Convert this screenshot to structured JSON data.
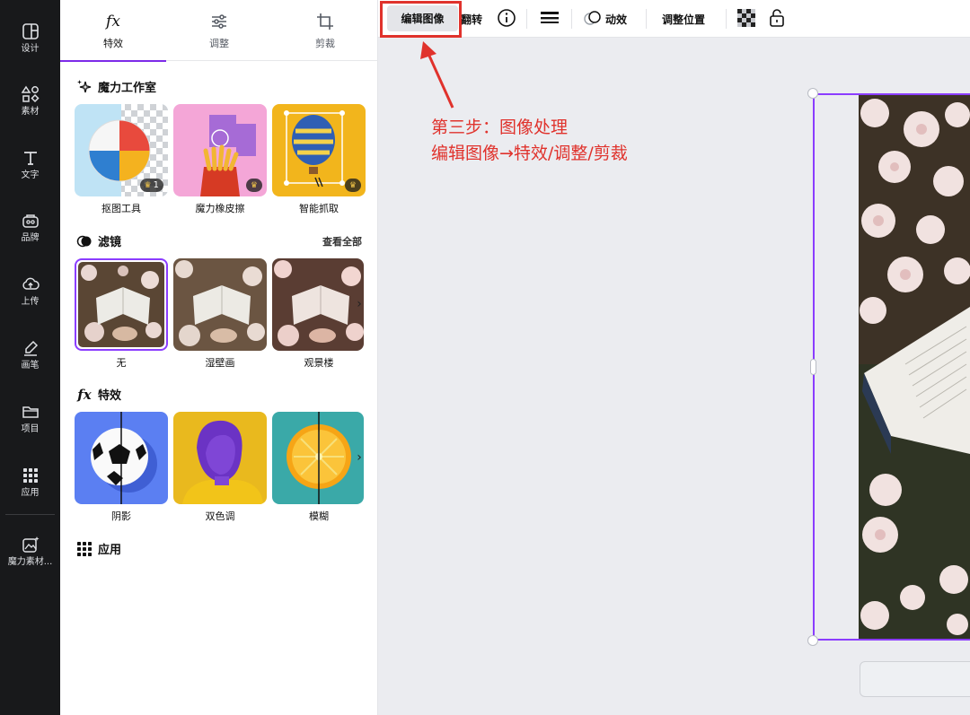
{
  "rail": {
    "items": [
      {
        "label": "设计",
        "icon": "layout-icon"
      },
      {
        "label": "素材",
        "icon": "shapes-icon"
      },
      {
        "label": "文字",
        "icon": "text-icon"
      },
      {
        "label": "品牌",
        "icon": "brand-icon"
      },
      {
        "label": "上传",
        "icon": "upload-cloud-icon"
      },
      {
        "label": "画笔",
        "icon": "brush-icon"
      },
      {
        "label": "项目",
        "icon": "folder-icon"
      },
      {
        "label": "应用",
        "icon": "apps-grid-icon"
      },
      {
        "label": "魔力素材...",
        "icon": "magic-media-icon"
      }
    ]
  },
  "panel": {
    "tabs": [
      {
        "label": "特效",
        "icon": "fx-icon",
        "active": true
      },
      {
        "label": "调整",
        "icon": "sliders-icon",
        "active": false
      },
      {
        "label": "剪裁",
        "icon": "crop-icon",
        "active": false
      }
    ],
    "magic_studio": {
      "title": "魔力工作室",
      "tools": [
        {
          "label": "抠图工具",
          "badge": "1"
        },
        {
          "label": "魔力橡皮擦",
          "badge": ""
        },
        {
          "label": "智能抓取",
          "badge": ""
        }
      ]
    },
    "filters": {
      "title": "滤镜",
      "see_all": "查看全部",
      "items": [
        {
          "label": "无",
          "selected": true
        },
        {
          "label": "湿壁画",
          "selected": false
        },
        {
          "label": "观景楼",
          "selected": false
        }
      ]
    },
    "effects": {
      "title": "特效",
      "items": [
        {
          "label": "阴影"
        },
        {
          "label": "双色调"
        },
        {
          "label": "模糊"
        }
      ]
    },
    "apps": {
      "title": "应用"
    }
  },
  "toolbar": {
    "edit_image": "编辑图像",
    "flip": "翻转",
    "animate": "动效",
    "position": "调整位置"
  },
  "annotation": {
    "line1": "第三步：图像处理",
    "line2": "编辑图像→特效/调整/剪裁"
  },
  "colors": {
    "accent": "#8b3dff",
    "annotation_red": "#e0322c",
    "rail_bg": "#18191b"
  }
}
